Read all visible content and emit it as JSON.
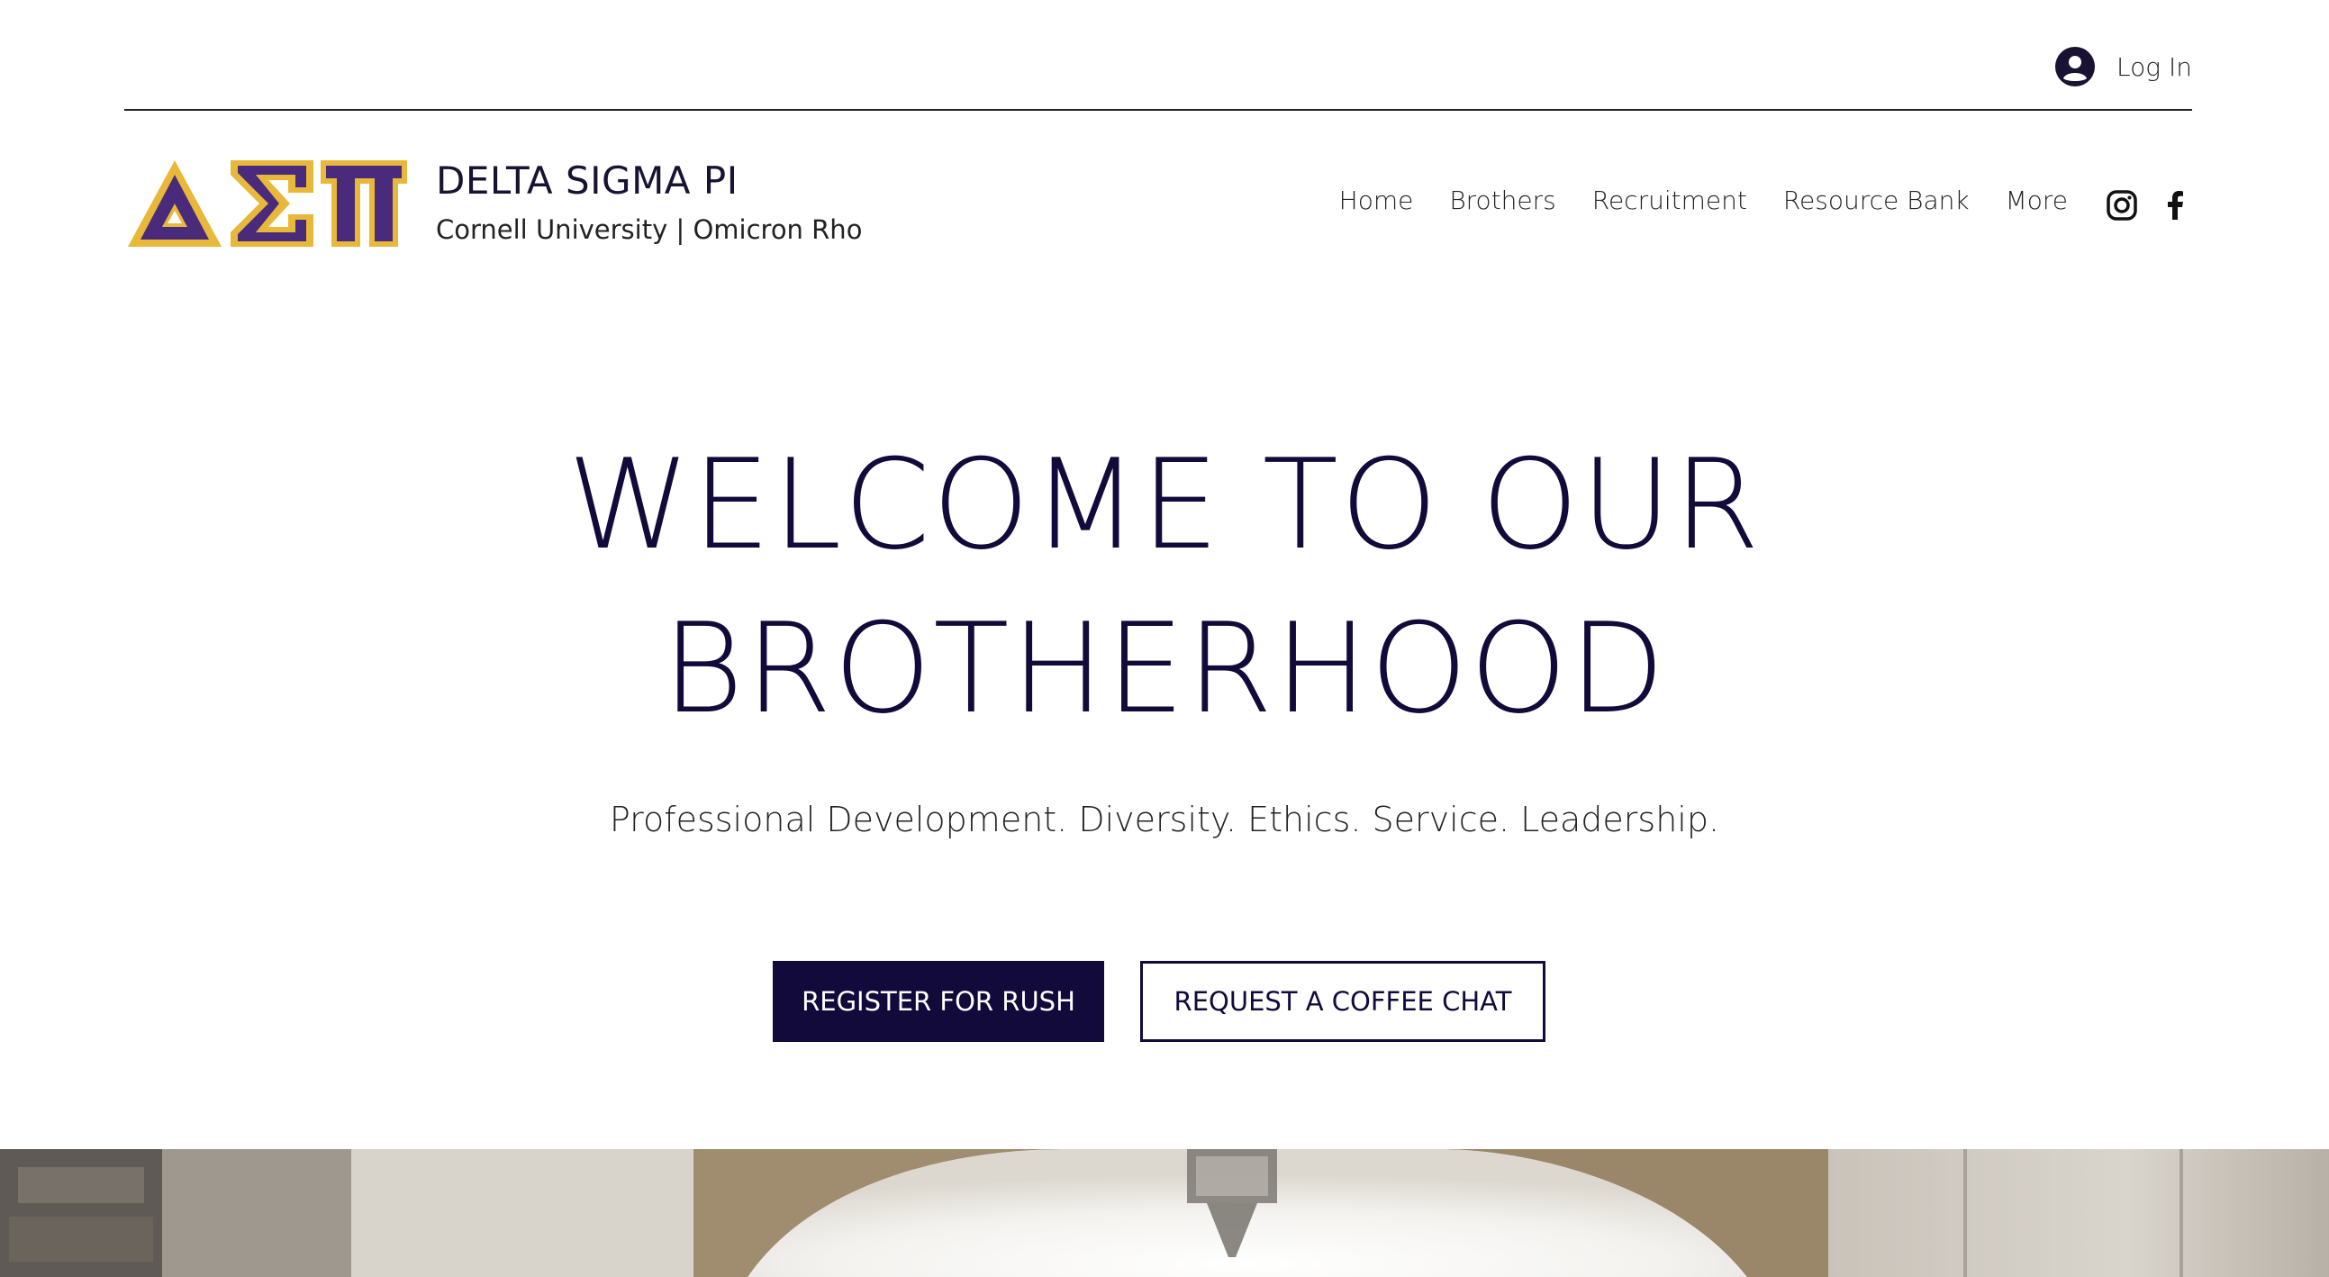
{
  "login": {
    "label": "Log In",
    "icon": "user-avatar-icon"
  },
  "brand": {
    "logo_letters": "ΔΣΠ",
    "title": "DELTA SIGMA PI",
    "subtitle": "Cornell University | Omicron Rho",
    "colors": {
      "purple": "#4a2a7a",
      "gold": "#e8b83a"
    }
  },
  "nav": {
    "items": [
      {
        "label": "Home"
      },
      {
        "label": "Brothers"
      },
      {
        "label": "Recruitment"
      },
      {
        "label": "Resource Bank"
      },
      {
        "label": "More"
      }
    ]
  },
  "social": {
    "icons": [
      "instagram-icon",
      "facebook-icon"
    ]
  },
  "hero": {
    "title_line1": "WELCOME TO OUR",
    "title_line2": "BROTHERHOOD",
    "subtitle": "Professional Development. Diversity. Ethics. Service. Leadership.",
    "primary_button": "REGISTER FOR RUSH",
    "secondary_button": "REQUEST A COFFEE CHAT",
    "accent_color": "#120a3a"
  }
}
